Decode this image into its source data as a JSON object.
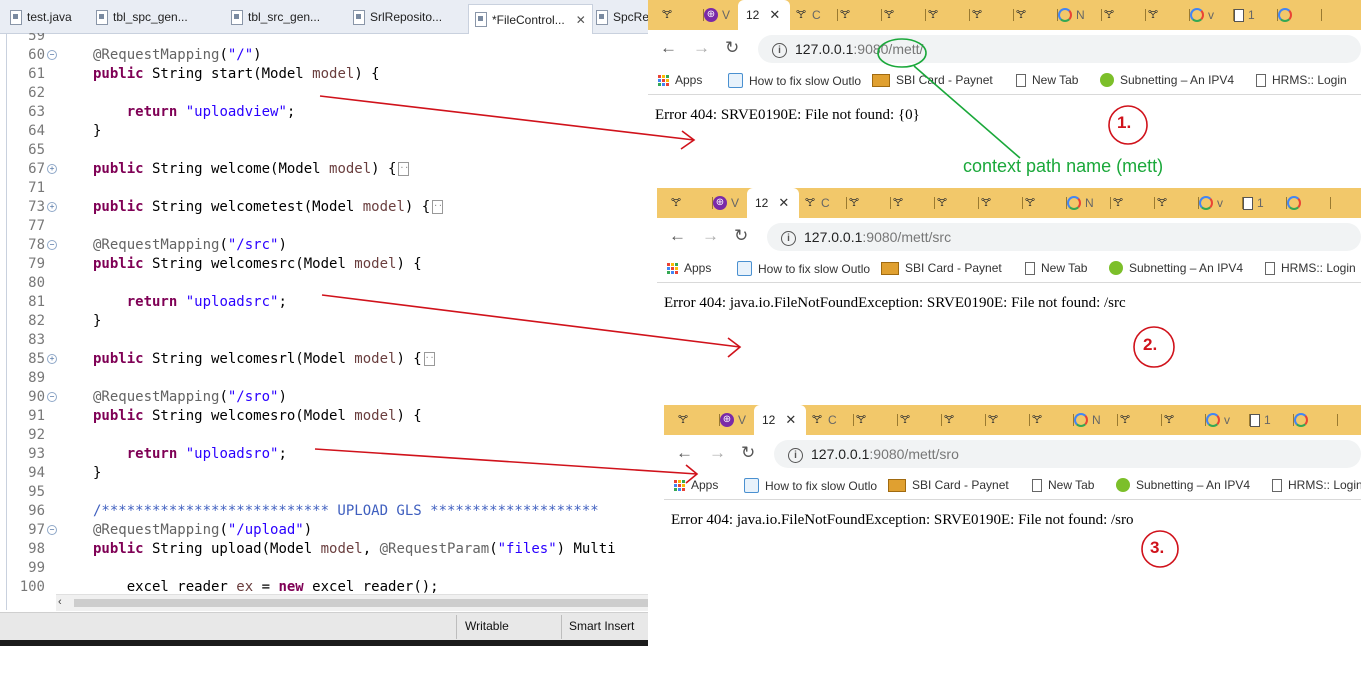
{
  "editor": {
    "tabs": [
      {
        "label": "test.java"
      },
      {
        "label": "tbl_spc_gen..."
      },
      {
        "label": "tbl_src_gen..."
      },
      {
        "label": "SrlReposito..."
      },
      {
        "label": "*FileControl..."
      },
      {
        "label": "SpcRep"
      }
    ],
    "status": {
      "writable": "Writable",
      "insert_mode": "Smart Insert"
    },
    "lines": [
      {
        "n": "59",
        "text": ""
      },
      {
        "n": "60",
        "text": "@RequestMapping(\"/\")"
      },
      {
        "n": "61",
        "text": "public String start(Model model) {"
      },
      {
        "n": "62",
        "text": ""
      },
      {
        "n": "63",
        "text": "    return \"uploadview\";"
      },
      {
        "n": "64",
        "text": "}"
      },
      {
        "n": "65",
        "text": ""
      },
      {
        "n": "67",
        "text": "public String welcome(Model model) {"
      },
      {
        "n": "71",
        "text": ""
      },
      {
        "n": "73",
        "text": "public String welcometest(Model model) {"
      },
      {
        "n": "77",
        "text": ""
      },
      {
        "n": "78",
        "text": "@RequestMapping(\"/src\")"
      },
      {
        "n": "79",
        "text": "public String welcomesrc(Model model) {"
      },
      {
        "n": "80",
        "text": ""
      },
      {
        "n": "81",
        "text": "    return \"uploadsrc\";"
      },
      {
        "n": "82",
        "text": "}"
      },
      {
        "n": "83",
        "text": ""
      },
      {
        "n": "85",
        "text": "public String welcomesrl(Model model) {"
      },
      {
        "n": "89",
        "text": ""
      },
      {
        "n": "90",
        "text": "@RequestMapping(\"/sro\")"
      },
      {
        "n": "91",
        "text": "public String welcomesro(Model model) {"
      },
      {
        "n": "92",
        "text": ""
      },
      {
        "n": "93",
        "text": "    return \"uploadsro\";"
      },
      {
        "n": "94",
        "text": "}"
      },
      {
        "n": "95",
        "text": ""
      },
      {
        "n": "96",
        "text": "/*************************** UPLOAD GLS ********************"
      },
      {
        "n": "97",
        "text": "@RequestMapping(\"/upload\")"
      },
      {
        "n": "98",
        "text": "public String upload(Model model, @RequestParam(\"files\") Multi"
      },
      {
        "n": "99",
        "text": ""
      },
      {
        "n": "100",
        "text": "    excel_reader ex = new excel_reader();"
      }
    ]
  },
  "browsers": [
    {
      "active_tab": "12",
      "url_host": "127.0.0.1",
      "url_rest": ":9080/mett/",
      "error": "Error 404: SRVE0190E: File not found: {0}",
      "marker": "1."
    },
    {
      "active_tab": "12",
      "url_host": "127.0.0.1",
      "url_rest": ":9080/mett/src",
      "error": "Error 404: java.io.FileNotFoundException: SRVE0190E: File not found: /src",
      "marker": "2."
    },
    {
      "active_tab": "12",
      "url_host": "127.0.0.1",
      "url_rest": ":9080/mett/sro",
      "error": "Error 404: java.io.FileNotFoundException: SRVE0190E: File not found: /sro",
      "marker": "3."
    }
  ],
  "tab_titles": [
    "",
    "V",
    "",
    "C",
    "",
    "",
    "",
    "",
    "",
    "N",
    "",
    "",
    "v",
    "1"
  ],
  "bookmarks": {
    "apps": "Apps",
    "fix": "How to fix slow Outlo",
    "sbi": "SBI Card - Paynet",
    "newtab": "New Tab",
    "subnet": "Subnetting – An IPV4",
    "hrms": "HRMS:: Login"
  },
  "annotation": {
    "context_label": "context path name (mett)"
  },
  "colors": {
    "annotation_red": "#d0121b",
    "annotation_green": "#1aa83a",
    "tab_strip": "#f2c86a"
  }
}
